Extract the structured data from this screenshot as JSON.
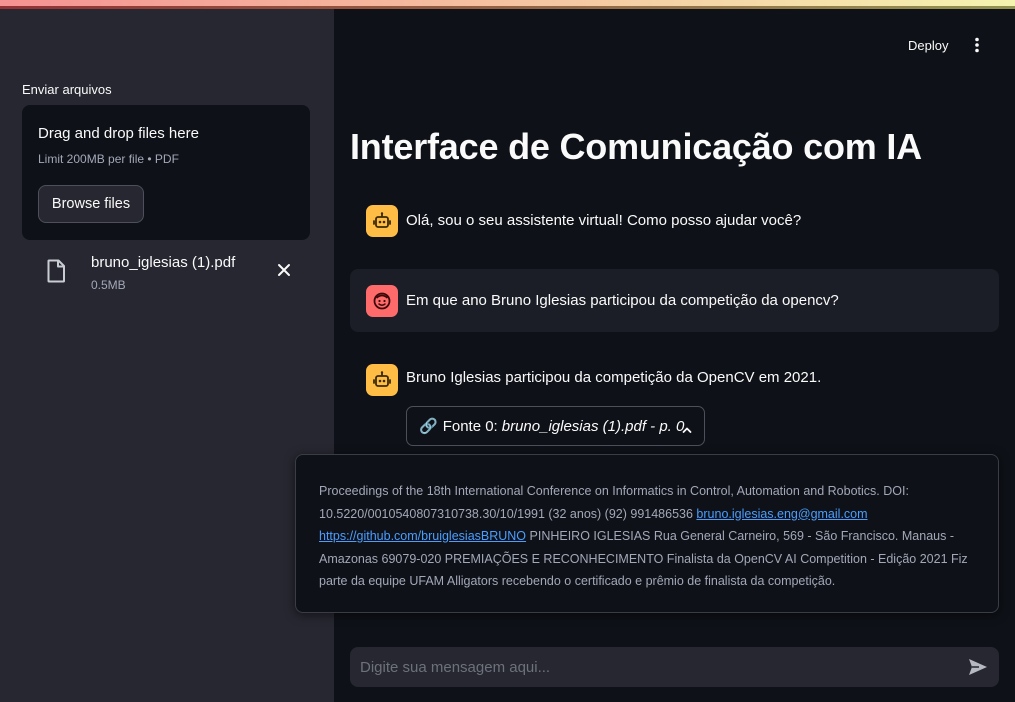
{
  "sidebar": {
    "uploader_label": "Enviar arquivos",
    "dropzone_title": "Drag and drop files here",
    "dropzone_subtitle": "Limit 200MB per file • PDF",
    "browse_label": "Browse files",
    "file": {
      "name": "bruno_iglesias (1).pdf",
      "size": "0.5MB"
    }
  },
  "header": {
    "deploy_label": "Deploy",
    "menu_icon": "more-vertical-icon"
  },
  "main": {
    "title": "Interface de Comunicação com IA",
    "messages": [
      {
        "role": "assistant",
        "text": "Olá, sou o seu assistente virtual! Como posso ajudar você?"
      },
      {
        "role": "user",
        "text": "Em que ano Bruno Iglesias participou da competição da opencv?"
      },
      {
        "role": "assistant",
        "text": "Bruno Iglesias participou da competição da OpenCV em 2021."
      }
    ],
    "source": {
      "icon": "🔗",
      "prefix": "Fonte 0:",
      "file": "bruno_iglesias (1).pdf - p. 0"
    },
    "popover": {
      "part1": "Proceedings of the 18th International Conference on Informatics in Control, Automation and Robotics. DOI: 10.5220/0010540807310738.30/10/1991 (32 anos) (92) 991486536 ",
      "email": "bruno.iglesias.eng@gmail.com",
      "link": "https://github.com/bruiglesiasBRUNO",
      "part2": " PINHEIRO IGLESIAS Rua General Carneiro, 569 - São Francisco. Manaus - Amazonas 69079-020 PREMIAÇÕES E RECONHECIMENTO Finalista da OpenCV AI Competition - Edição 2021 Fiz parte da equipe UFAM Alligators recebendo o certificado e prêmio de finalista da competição."
    },
    "input": {
      "placeholder": "Digite sua mensagem aqui..."
    }
  },
  "colors": {
    "background": "#0e1117",
    "sidebar": "#262730",
    "bot_avatar": "#ffbd45",
    "user_avatar": "#ff6b6b",
    "link": "#4a9eff"
  }
}
